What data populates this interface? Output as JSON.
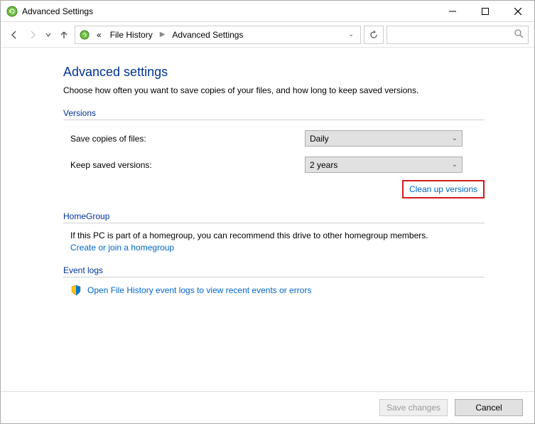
{
  "window": {
    "title": "Advanced Settings"
  },
  "breadcrumb": {
    "prefix": "«",
    "parent": "File History",
    "current": "Advanced Settings"
  },
  "page": {
    "title": "Advanced settings",
    "description": "Choose how often you want to save copies of your files, and how long to keep saved versions."
  },
  "sections": {
    "versions": {
      "header": "Versions",
      "save_copies_label": "Save copies of files:",
      "save_copies_value": "Daily",
      "keep_versions_label": "Keep saved versions:",
      "keep_versions_value": "2 years",
      "cleanup_link": "Clean up versions"
    },
    "homegroup": {
      "header": "HomeGroup",
      "text": "If this PC is part of a homegroup, you can recommend this drive to other homegroup members.",
      "link": "Create or join a homegroup"
    },
    "eventlogs": {
      "header": "Event logs",
      "link": "Open File History event logs to view recent events or errors"
    }
  },
  "footer": {
    "save": "Save changes",
    "cancel": "Cancel"
  }
}
